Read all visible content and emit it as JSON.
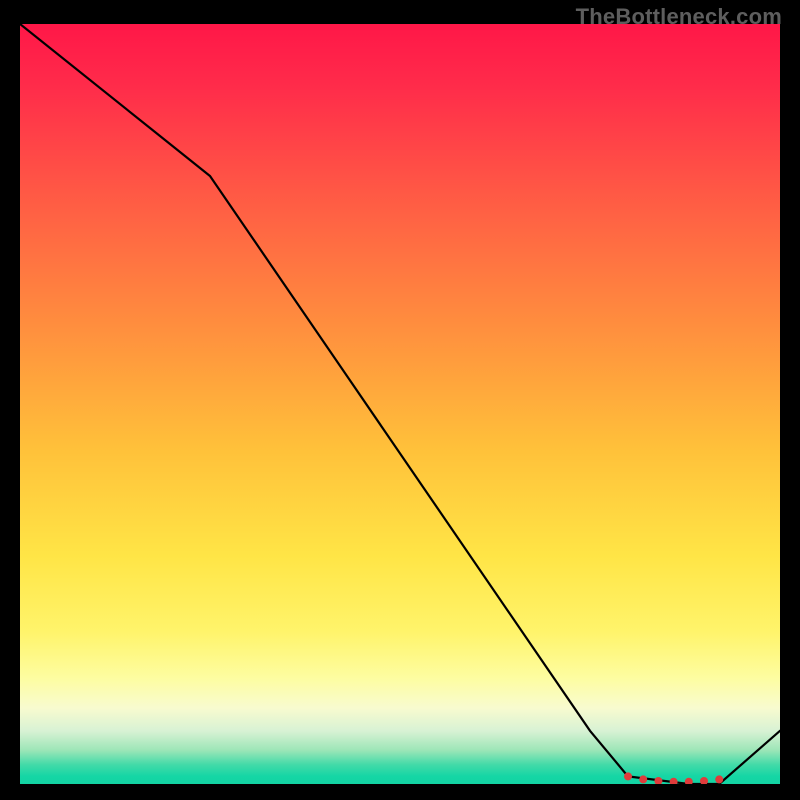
{
  "watermark": "TheBottleneck.com",
  "chart_data": {
    "type": "line",
    "title": "",
    "xlabel": "",
    "ylabel": "",
    "xlim": [
      0,
      100
    ],
    "ylim": [
      0,
      100
    ],
    "series": [
      {
        "name": "bottleneck-curve",
        "x": [
          0,
          25,
          75,
          80,
          88,
          92,
          100
        ],
        "values": [
          100,
          80,
          7,
          1,
          0,
          0,
          7
        ]
      }
    ],
    "markers": {
      "name": "optimal-range-dots",
      "x": [
        80,
        82,
        84,
        86,
        88,
        90,
        92
      ],
      "values": [
        1,
        0.6,
        0.4,
        0.3,
        0.3,
        0.4,
        0.6
      ]
    }
  }
}
